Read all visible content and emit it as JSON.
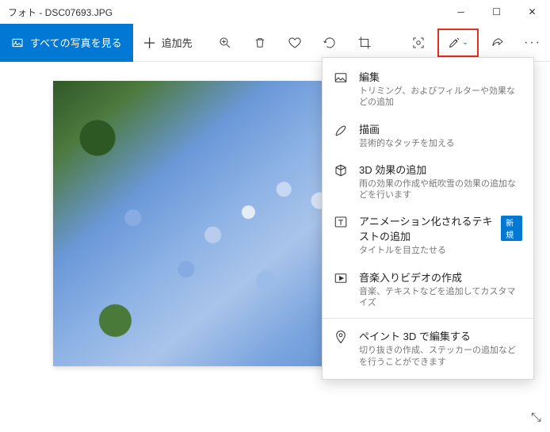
{
  "titlebar": {
    "title": "フォト - DSC07693.JPG"
  },
  "toolbar": {
    "see_all": "すべての写真を見る",
    "add_to": "追加先"
  },
  "menu": {
    "items": [
      {
        "title": "編集",
        "desc": "トリミング、およびフィルターや効果などの追加"
      },
      {
        "title": "描画",
        "desc": "芸術的なタッチを加える"
      },
      {
        "title": "3D 効果の追加",
        "desc": "雨の効果の作成や紙吹雪の効果の追加などを行います"
      },
      {
        "title": "アニメーション化されるテキストの追加",
        "desc": "タイトルを目立たせる",
        "badge": "新規"
      },
      {
        "title": "音楽入りビデオの作成",
        "desc": "音楽、テキストなどを追加してカスタマイズ"
      },
      {
        "title": "ペイント 3D で編集する",
        "desc": "切り抜きの作成、ステッカーの追加などを行うことができます"
      }
    ]
  }
}
